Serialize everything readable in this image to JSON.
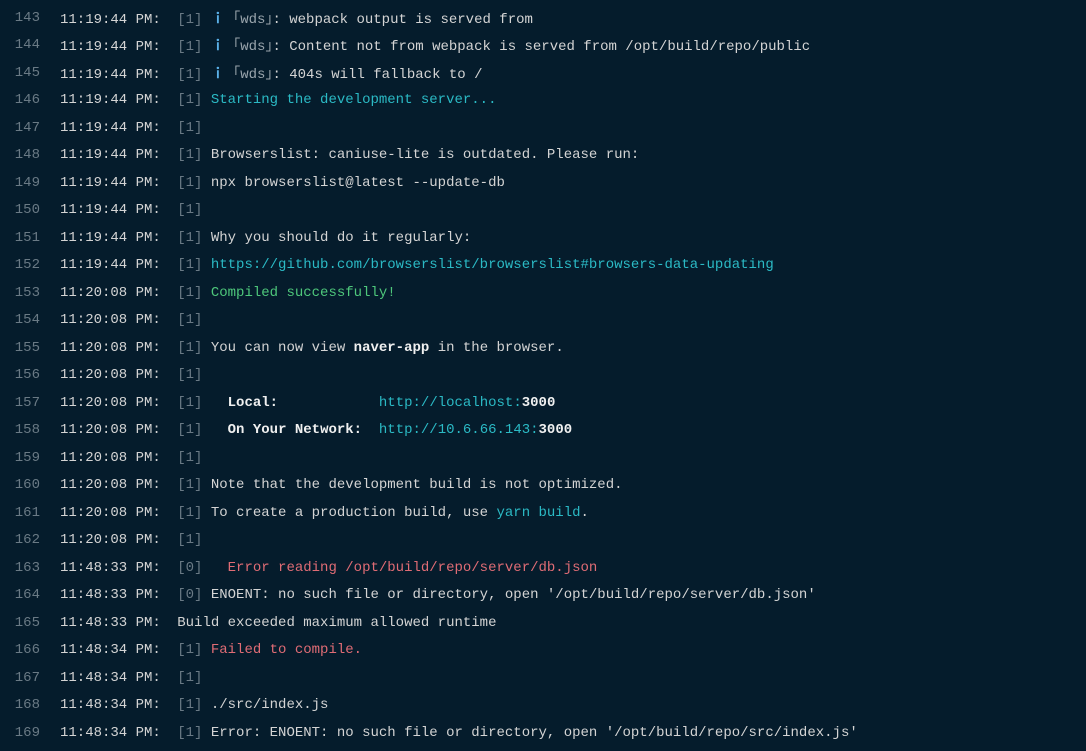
{
  "lines": [
    {
      "num": "143",
      "ts": "11:19:44 PM:",
      "proc": "[1]",
      "segs": [
        {
          "cls": "info-icon",
          "t": " ｉ"
        },
        {
          "cls": "wds",
          "t": " ｢wds｣"
        },
        {
          "cls": "normal",
          "t": ": webpack output is served from"
        }
      ]
    },
    {
      "num": "144",
      "ts": "11:19:44 PM:",
      "proc": "[1]",
      "segs": [
        {
          "cls": "info-icon",
          "t": " ｉ"
        },
        {
          "cls": "wds",
          "t": " ｢wds｣"
        },
        {
          "cls": "normal",
          "t": ": Content not from webpack is served from /opt/build/repo/public"
        }
      ]
    },
    {
      "num": "145",
      "ts": "11:19:44 PM:",
      "proc": "[1]",
      "segs": [
        {
          "cls": "info-icon",
          "t": " ｉ"
        },
        {
          "cls": "wds",
          "t": " ｢wds｣"
        },
        {
          "cls": "normal",
          "t": ": 404s will fallback to /"
        }
      ]
    },
    {
      "num": "146",
      "ts": "11:19:44 PM:",
      "proc": "[1]",
      "segs": [
        {
          "cls": "cyan",
          "t": " Starting the development server..."
        }
      ]
    },
    {
      "num": "147",
      "ts": "11:19:44 PM:",
      "proc": "[1]",
      "segs": []
    },
    {
      "num": "148",
      "ts": "11:19:44 PM:",
      "proc": "[1]",
      "segs": [
        {
          "cls": "normal",
          "t": " Browserslist: caniuse-lite is outdated. Please run:"
        }
      ]
    },
    {
      "num": "149",
      "ts": "11:19:44 PM:",
      "proc": "[1]",
      "segs": [
        {
          "cls": "normal",
          "t": " npx browserslist@latest --update-db"
        }
      ]
    },
    {
      "num": "150",
      "ts": "11:19:44 PM:",
      "proc": "[1]",
      "segs": []
    },
    {
      "num": "151",
      "ts": "11:19:44 PM:",
      "proc": "[1]",
      "segs": [
        {
          "cls": "normal",
          "t": " Why you should do it regularly:"
        }
      ]
    },
    {
      "num": "152",
      "ts": "11:19:44 PM:",
      "proc": "[1]",
      "segs": [
        {
          "cls": "cyan",
          "t": " https://github.com/browserslist/browserslist#browsers-data-updating"
        }
      ]
    },
    {
      "num": "153",
      "ts": "11:20:08 PM:",
      "proc": "[1]",
      "segs": [
        {
          "cls": "green",
          "t": " Compiled successfully!"
        }
      ]
    },
    {
      "num": "154",
      "ts": "11:20:08 PM:",
      "proc": "[1]",
      "segs": []
    },
    {
      "num": "155",
      "ts": "11:20:08 PM:",
      "proc": "[1]",
      "segs": [
        {
          "cls": "normal",
          "t": " You can now view "
        },
        {
          "cls": "bold",
          "t": "naver-app"
        },
        {
          "cls": "normal",
          "t": " in the browser."
        }
      ]
    },
    {
      "num": "156",
      "ts": "11:20:08 PM:",
      "proc": "[1]",
      "segs": []
    },
    {
      "num": "157",
      "ts": "11:20:08 PM:",
      "proc": "[1]",
      "segs": [
        {
          "cls": "normal",
          "t": "   "
        },
        {
          "cls": "bold",
          "t": "Local:"
        },
        {
          "cls": "normal",
          "t": "            "
        },
        {
          "cls": "cyan",
          "t": "http://localhost:"
        },
        {
          "cls": "bold",
          "t": "3000"
        }
      ]
    },
    {
      "num": "158",
      "ts": "11:20:08 PM:",
      "proc": "[1]",
      "segs": [
        {
          "cls": "normal",
          "t": "   "
        },
        {
          "cls": "bold",
          "t": "On Your Network:"
        },
        {
          "cls": "normal",
          "t": "  "
        },
        {
          "cls": "cyan",
          "t": "http://10.6.66.143:"
        },
        {
          "cls": "bold",
          "t": "3000"
        }
      ]
    },
    {
      "num": "159",
      "ts": "11:20:08 PM:",
      "proc": "[1]",
      "segs": []
    },
    {
      "num": "160",
      "ts": "11:20:08 PM:",
      "proc": "[1]",
      "segs": [
        {
          "cls": "normal",
          "t": " Note that the development build is not optimized."
        }
      ]
    },
    {
      "num": "161",
      "ts": "11:20:08 PM:",
      "proc": "[1]",
      "segs": [
        {
          "cls": "normal",
          "t": " To create a production build, use "
        },
        {
          "cls": "cyan",
          "t": "yarn build"
        },
        {
          "cls": "normal",
          "t": "."
        }
      ]
    },
    {
      "num": "162",
      "ts": "11:20:08 PM:",
      "proc": "[1]",
      "segs": []
    },
    {
      "num": "163",
      "ts": "11:48:33 PM:",
      "proc": "[0]",
      "segs": [
        {
          "cls": "red",
          "t": "   Error reading /opt/build/repo/server/db.json"
        }
      ]
    },
    {
      "num": "164",
      "ts": "11:48:33 PM:",
      "proc": "[0]",
      "segs": [
        {
          "cls": "normal",
          "t": " ENOENT: no such file or directory, open '/opt/build/repo/server/db.json'"
        }
      ]
    },
    {
      "num": "165",
      "ts": "11:48:33 PM:",
      "proc": "",
      "segs": [
        {
          "cls": "normal",
          "t": "Build exceeded maximum allowed runtime"
        }
      ]
    },
    {
      "num": "166",
      "ts": "11:48:34 PM:",
      "proc": "[1]",
      "segs": [
        {
          "cls": "red",
          "t": " Failed to compile."
        }
      ]
    },
    {
      "num": "167",
      "ts": "11:48:34 PM:",
      "proc": "[1]",
      "segs": []
    },
    {
      "num": "168",
      "ts": "11:48:34 PM:",
      "proc": "[1]",
      "segs": [
        {
          "cls": "normal",
          "t": " ./src/index.js"
        }
      ]
    },
    {
      "num": "169",
      "ts": "11:48:34 PM:",
      "proc": "[1]",
      "segs": [
        {
          "cls": "normal",
          "t": " Error: ENOENT: no such file or directory, open '/opt/build/repo/src/index.js'"
        }
      ]
    }
  ]
}
